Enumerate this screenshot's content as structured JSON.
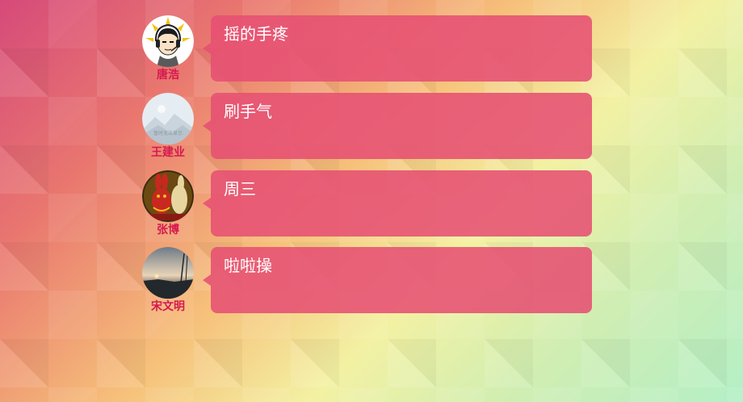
{
  "messages": [
    {
      "name": "唐浩",
      "text": "摇的手疼",
      "avatar": "cartoon-man-headphones"
    },
    {
      "name": "王建业",
      "text": "刷手气",
      "avatar": "placeholder-image",
      "avatar_caption": "暂时无法显示"
    },
    {
      "name": "张博",
      "text": "周三",
      "avatar": "rabbit-figurine"
    },
    {
      "name": "宋文明",
      "text": "啦啦操",
      "avatar": "sunset-landscape"
    }
  ],
  "colors": {
    "bubble": "#e65073",
    "name": "#d6194f",
    "text": "#ffffff"
  }
}
